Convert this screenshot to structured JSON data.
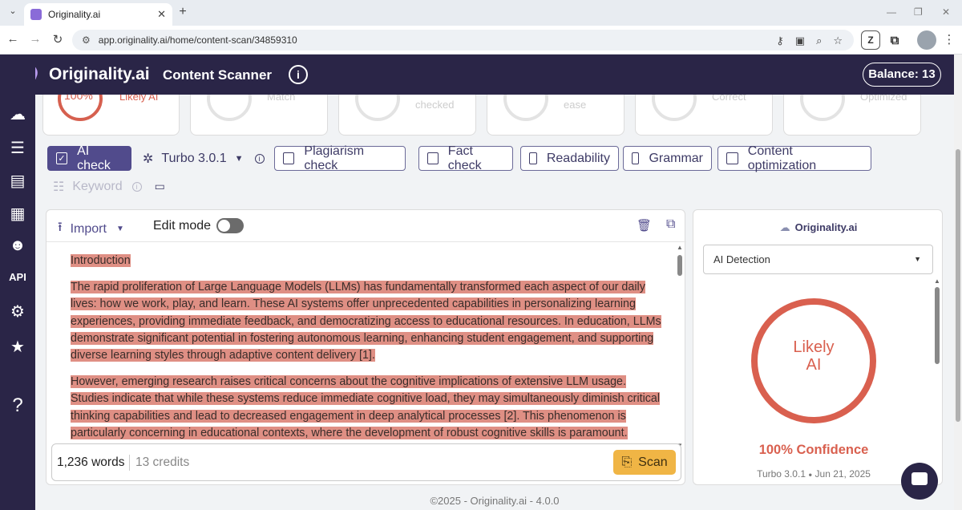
{
  "browser": {
    "tab_title": "Originality.ai",
    "url": "app.originality.ai/home/content-scan/34859310"
  },
  "header": {
    "brand": "Originality.ai",
    "module": "Content Scanner",
    "balance": "Balance: 13"
  },
  "sidebar": {
    "items": [
      {
        "name": "brain-icon"
      },
      {
        "name": "stack-icon"
      },
      {
        "name": "scan-icon"
      },
      {
        "name": "news-icon"
      },
      {
        "name": "team-icon"
      },
      {
        "name": "api",
        "label": "API"
      },
      {
        "name": "gear-icon"
      },
      {
        "name": "star-icon"
      },
      {
        "name": "help",
        "label": "?"
      }
    ]
  },
  "cards": [
    {
      "value": "100%",
      "label": "Likely AI"
    },
    {
      "label": "Match"
    },
    {
      "label": "checked"
    },
    {
      "label": "ease"
    },
    {
      "label": "Correct"
    },
    {
      "label": "Optimized"
    }
  ],
  "options": {
    "ai_check": "AI check",
    "model": "Turbo 3.0.1",
    "plagiarism": "Plagiarism check",
    "fact": "Fact check",
    "readability": "Readability",
    "grammar": "Grammar",
    "content_opt": "Content optimization",
    "keyword": "Keyword"
  },
  "editor": {
    "import": "Import",
    "edit_mode": "Edit mode",
    "heading": "Introduction",
    "p1": "The rapid proliferation of Large Language Models (LLMs) has fundamentally transformed each aspect of our daily lives: how we work, play, and learn.  These AI systems offer unprecedented capabilities in personalizing learning experiences, providing immediate feedback, and democratizing access to educational resources.  In education, LLMs demonstrate significant potential in fostering autonomous learning, enhancing student engagement, and supporting diverse learning styles through adaptive content delivery [1].",
    "p2": "However, emerging research raises critical concerns about the cognitive implications of extensive LLM usage.  Studies indicate that while these systems reduce immediate cognitive load, they may simultaneously diminish critical thinking capabilities and lead to decreased engagement in deep analytical processes [2].  This phenomenon is particularly concerning in educational contexts, where the development of robust cognitive skills is paramount.",
    "words": "1,236 words",
    "credits": "13 credits",
    "scan": "Scan"
  },
  "result": {
    "brand": "Originality.ai",
    "dropdown": "AI Detection",
    "ring_label": "Likely AI",
    "ring_fill": 1.0,
    "confidence": "100% Confidence",
    "model": "Turbo 3.0.1",
    "date": "Jun 21, 2025"
  },
  "footer": "©2025 - Originality.ai - 4.0.0",
  "colors": {
    "brand_dark": "#2a2547",
    "accent": "#514b8c",
    "ai_red": "#d9604f",
    "highlight": "#df8f84",
    "scan_yellow": "#f0b545"
  }
}
